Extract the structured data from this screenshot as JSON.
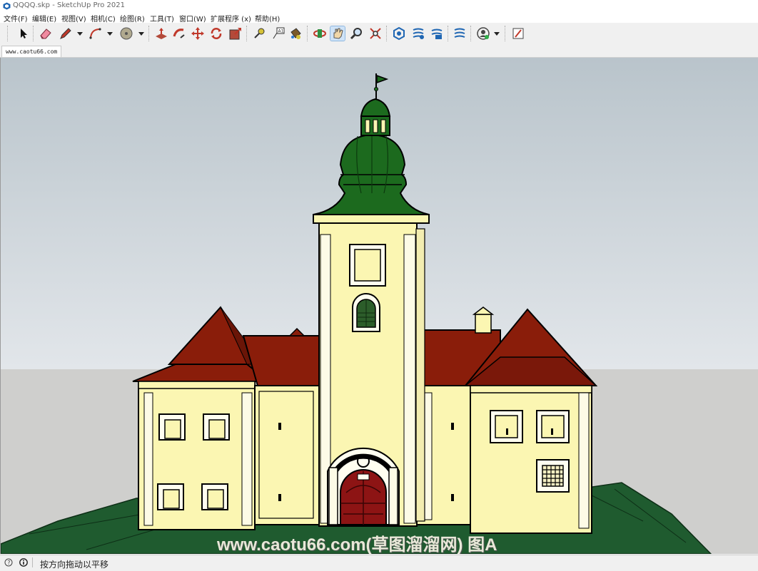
{
  "window": {
    "title": "QQQQ.skp - SketchUp Pro 2021"
  },
  "menu": {
    "items": [
      {
        "label": "文件(F)"
      },
      {
        "label": "编辑(E)"
      },
      {
        "label": "视图(V)"
      },
      {
        "label": "相机(C)"
      },
      {
        "label": "绘图(R)"
      },
      {
        "label": "工具(T)"
      },
      {
        "label": "窗口(W)"
      },
      {
        "label": "扩展程序 (x)"
      },
      {
        "label": "帮助(H)"
      }
    ]
  },
  "toolbar": {
    "tools": [
      {
        "icon": "select-arrow-icon"
      },
      {
        "icon": "eraser-icon"
      },
      {
        "icon": "pencil-line-icon"
      },
      {
        "icon": "arc-icon"
      },
      {
        "icon": "circle-shape-icon"
      },
      {
        "icon": "push-pull-icon"
      },
      {
        "icon": "follow-me-icon"
      },
      {
        "icon": "move-icon"
      },
      {
        "icon": "rotate-icon"
      },
      {
        "icon": "scale-icon"
      },
      {
        "icon": "tape-measure-icon"
      },
      {
        "icon": "text-label-icon"
      },
      {
        "icon": "paint-bucket-icon"
      },
      {
        "icon": "orbit-icon"
      },
      {
        "icon": "pan-hand-icon",
        "active": true
      },
      {
        "icon": "zoom-icon"
      },
      {
        "icon": "zoom-extents-icon"
      },
      {
        "icon": "3d-warehouse-icon"
      },
      {
        "icon": "extension-warehouse-icon"
      },
      {
        "icon": "layout-send-icon"
      },
      {
        "icon": "extension-manager-icon"
      },
      {
        "icon": "user-account-icon"
      },
      {
        "icon": "add-location-icon"
      }
    ]
  },
  "scene_tabs": [
    {
      "label": "www.caotu66.com"
    }
  ],
  "viewport": {
    "watermark": "www.caotu66.com(草图溜溜网) 图A",
    "colors": {
      "sky_top": "#b9c4cb",
      "sky_bottom": "#e2e6ea",
      "ground": "#cfcfcd",
      "terrain": "#1f5b2f",
      "wall": "#fbf6b2",
      "roof": "#8a1d0a",
      "dome": "#1c6a1e",
      "door": "#8d1414"
    }
  },
  "status": {
    "hint": "按方向拖动以平移"
  }
}
